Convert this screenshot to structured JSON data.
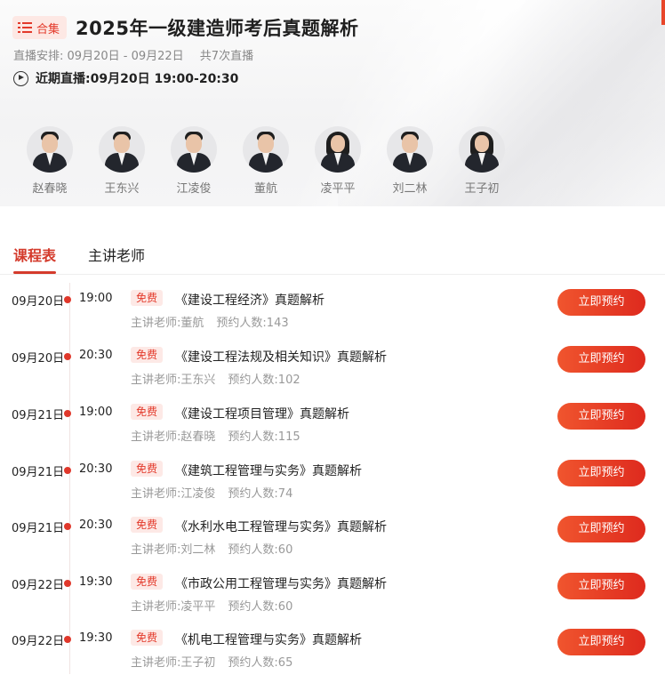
{
  "header": {
    "badge_label": "合集",
    "title": "2025年一级建造师考后真题解析",
    "schedule_prefix": "直播安排:",
    "schedule_dates": "09月20日 - 09月22日",
    "schedule_total": "共7次直播",
    "recent_label": "近期直播:",
    "recent_value": "09月20日 19:00-20:30"
  },
  "teachers": [
    {
      "name": "赵春晓",
      "gender": "male"
    },
    {
      "name": "王东兴",
      "gender": "male"
    },
    {
      "name": "江凌俊",
      "gender": "male"
    },
    {
      "name": "董航",
      "gender": "male"
    },
    {
      "name": "凌平平",
      "gender": "female"
    },
    {
      "name": "刘二林",
      "gender": "male"
    },
    {
      "name": "王子初",
      "gender": "female"
    }
  ],
  "tabs": {
    "schedule": "课程表",
    "teachers": "主讲老师"
  },
  "lessons": [
    {
      "date": "09月20日",
      "time": "19:00",
      "free": "免费",
      "course": "《建设工程经济》真题解析",
      "teacher_label": "主讲老师:",
      "teacher": "董航",
      "count_label": "预约人数:",
      "count": "143",
      "button": "立即预约"
    },
    {
      "date": "09月20日",
      "time": "20:30",
      "free": "免费",
      "course": "《建设工程法规及相关知识》真题解析",
      "teacher_label": "主讲老师:",
      "teacher": "王东兴",
      "count_label": "预约人数:",
      "count": "102",
      "button": "立即预约"
    },
    {
      "date": "09月21日",
      "time": "19:00",
      "free": "免费",
      "course": "《建设工程项目管理》真题解析",
      "teacher_label": "主讲老师:",
      "teacher": "赵春晓",
      "count_label": "预约人数:",
      "count": "115",
      "button": "立即预约"
    },
    {
      "date": "09月21日",
      "time": "20:30",
      "free": "免费",
      "course": "《建筑工程管理与实务》真题解析",
      "teacher_label": "主讲老师:",
      "teacher": "江凌俊",
      "count_label": "预约人数:",
      "count": "74",
      "button": "立即预约"
    },
    {
      "date": "09月21日",
      "time": "20:30",
      "free": "免费",
      "course": "《水利水电工程管理与实务》真题解析",
      "teacher_label": "主讲老师:",
      "teacher": "刘二林",
      "count_label": "预约人数:",
      "count": "60",
      "button": "立即预约"
    },
    {
      "date": "09月22日",
      "time": "19:30",
      "free": "免费",
      "course": "《市政公用工程管理与实务》真题解析",
      "teacher_label": "主讲老师:",
      "teacher": "凌平平",
      "count_label": "预约人数:",
      "count": "60",
      "button": "立即预约"
    },
    {
      "date": "09月22日",
      "time": "19:30",
      "free": "免费",
      "course": "《机电工程管理与实务》真题解析",
      "teacher_label": "主讲老师:",
      "teacher": "王子初",
      "count_label": "预约人数:",
      "count": "65",
      "button": "立即预约"
    }
  ],
  "colors": {
    "accent": "#e3392a",
    "button_start": "#f0552e",
    "button_end": "#de2a1e",
    "free_badge_bg": "#fde9e6"
  }
}
